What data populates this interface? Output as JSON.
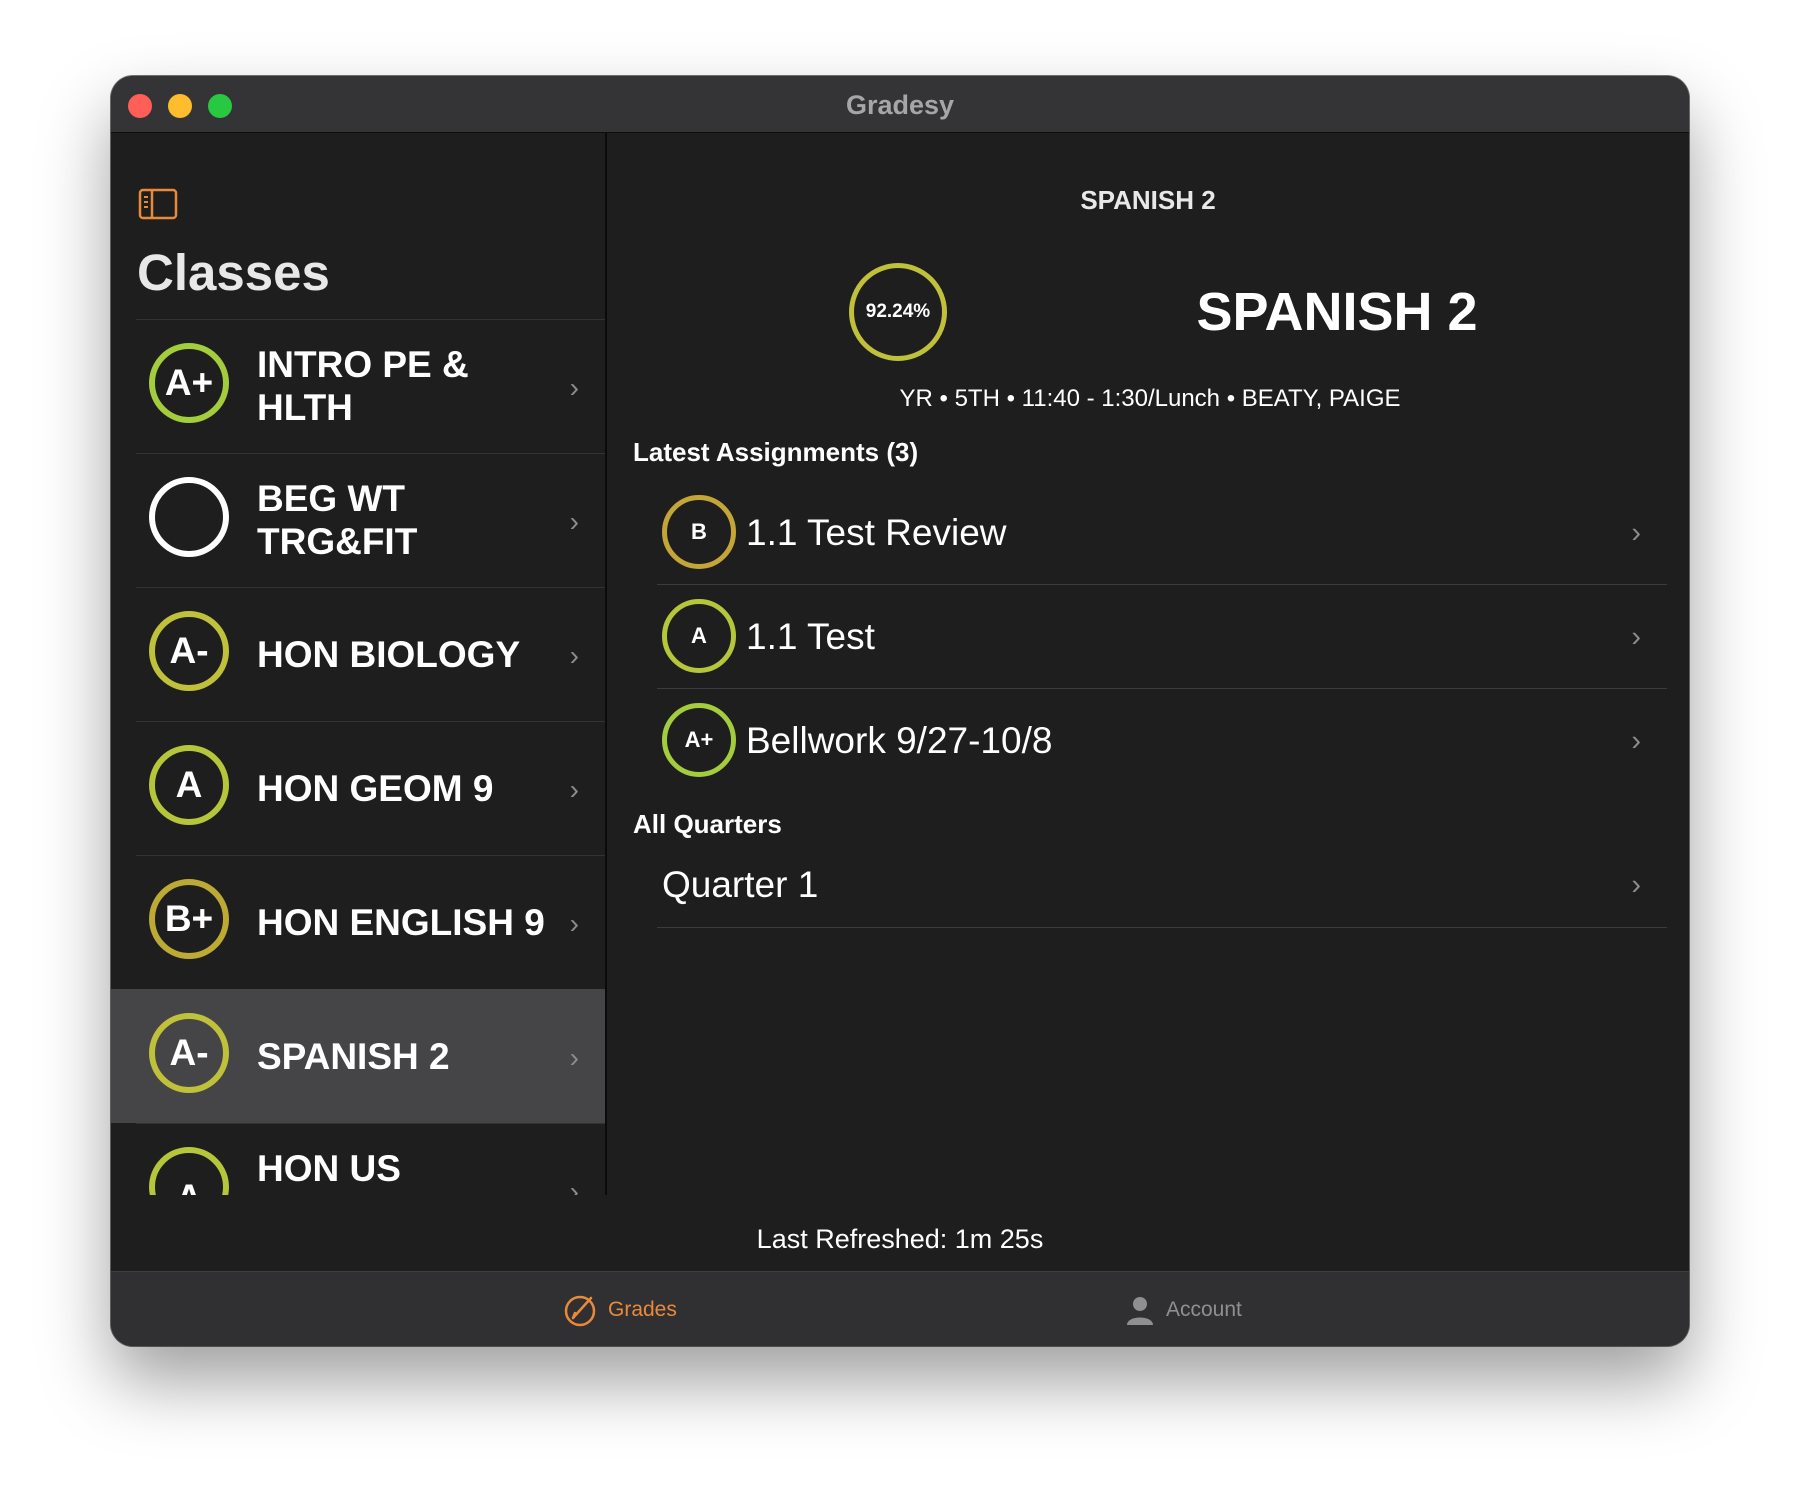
{
  "window": {
    "title": "Gradesy"
  },
  "sidebar": {
    "title": "Classes",
    "classes": [
      {
        "grade": "A+",
        "name": "INTRO PE & HLTH",
        "ring_color": "#a3cd3c",
        "selected": false
      },
      {
        "grade": "",
        "name": "BEG WT TRG&FIT",
        "ring_color": "#ffffff",
        "selected": false
      },
      {
        "grade": "A-",
        "name": "HON BIOLOGY",
        "ring_color": "#c0c13a",
        "selected": false
      },
      {
        "grade": "A",
        "name": "HON GEOM 9",
        "ring_color": "#b5c63a",
        "selected": false
      },
      {
        "grade": "B+",
        "name": "HON ENGLISH 9",
        "ring_color": "#bcaa34",
        "selected": false
      },
      {
        "grade": "A-",
        "name": "SPANISH 2",
        "ring_color": "#c0c13a",
        "selected": true
      },
      {
        "grade": "A",
        "name": "HON US",
        "ring_color": "#b5c63a",
        "selected": false
      }
    ]
  },
  "detail": {
    "nav_title": "SPANISH 2",
    "percent": "92.24%",
    "percent_ring_color": "#c0c13a",
    "class_title": "SPANISH 2",
    "meta": "YR • 5TH • 11:40 - 1:30/Lunch • BEATY, PAIGE",
    "assignments_header": "Latest Assignments (3)",
    "assignments": [
      {
        "grade": "B",
        "name": "1.1 Test Review",
        "ring_color": "#c4a538"
      },
      {
        "grade": "A",
        "name": "1.1 Test",
        "ring_color": "#b5c63a"
      },
      {
        "grade": "A+",
        "name": "Bellwork 9/27-10/8",
        "ring_color": "#a3cd3c"
      }
    ],
    "quarters_header": "All Quarters",
    "quarters": [
      {
        "name": "Quarter 1"
      }
    ]
  },
  "footer": {
    "last_refreshed": "Last Refreshed: 1m 25s"
  },
  "tabs": [
    {
      "label": "Grades",
      "icon": "grades-icon",
      "active": true,
      "color": "#e98a3a"
    },
    {
      "label": "Account",
      "icon": "person-icon",
      "active": false,
      "color": "#8f8f8f"
    }
  ]
}
